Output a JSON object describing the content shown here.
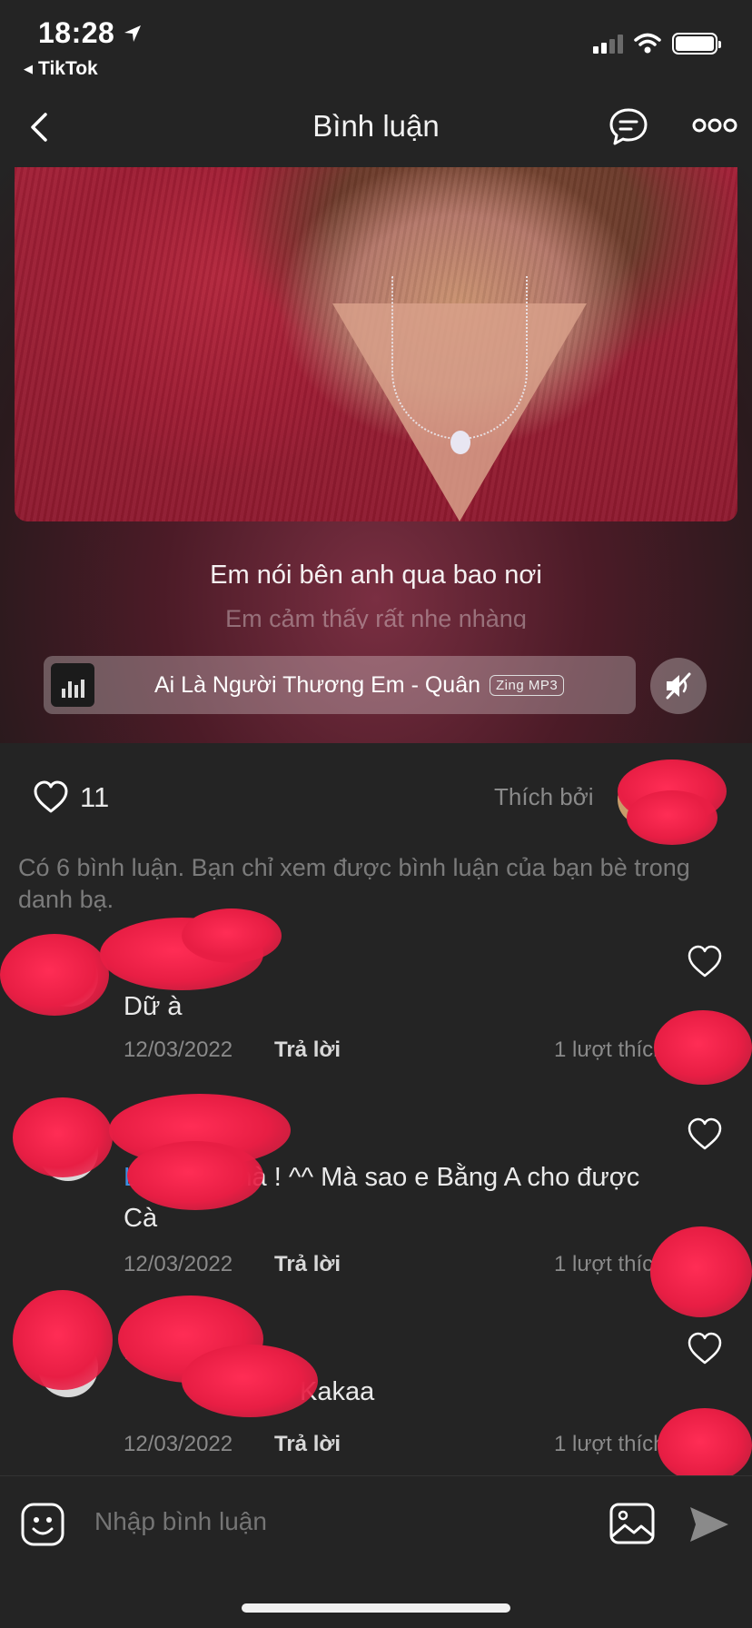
{
  "status_bar": {
    "time": "18:28",
    "back_app": "TikTok"
  },
  "nav": {
    "title": "Bình luận"
  },
  "media": {
    "lyric_current": "Em nói bên anh qua bao nơi",
    "lyric_next": "Em cảm thấy rất nhẹ nhàng",
    "song": "Ai Là Người Thương Em - Quân",
    "source_badge": "Zing MP3"
  },
  "likes": {
    "count": "11",
    "liked_by_label": "Thích bởi"
  },
  "info_text": "Có 6 bình luận. Bạn chỉ xem được bình luận của bạn bè trong danh bạ.",
  "comments": [
    {
      "text": "Dữ à",
      "date": "12/03/2022",
      "reply_label": "Trả lời",
      "likes": "1 lượt thích"
    },
    {
      "mention": "Lin",
      "text": " Vợ A mà ! ^^ Mà sao e Bằng A cho được Cà",
      "date": "12/03/2022",
      "reply_label": "Trả lời",
      "likes": "1 lượt thích"
    },
    {
      "text": "Kakaa",
      "date": "12/03/2022",
      "reply_label": "Trả lời",
      "likes": "1 lượt thích"
    }
  ],
  "input": {
    "placeholder": "Nhập bình luận"
  },
  "colors": {
    "background": "#242424",
    "mention": "#3b8fe0",
    "redaction": "#e81e44"
  }
}
